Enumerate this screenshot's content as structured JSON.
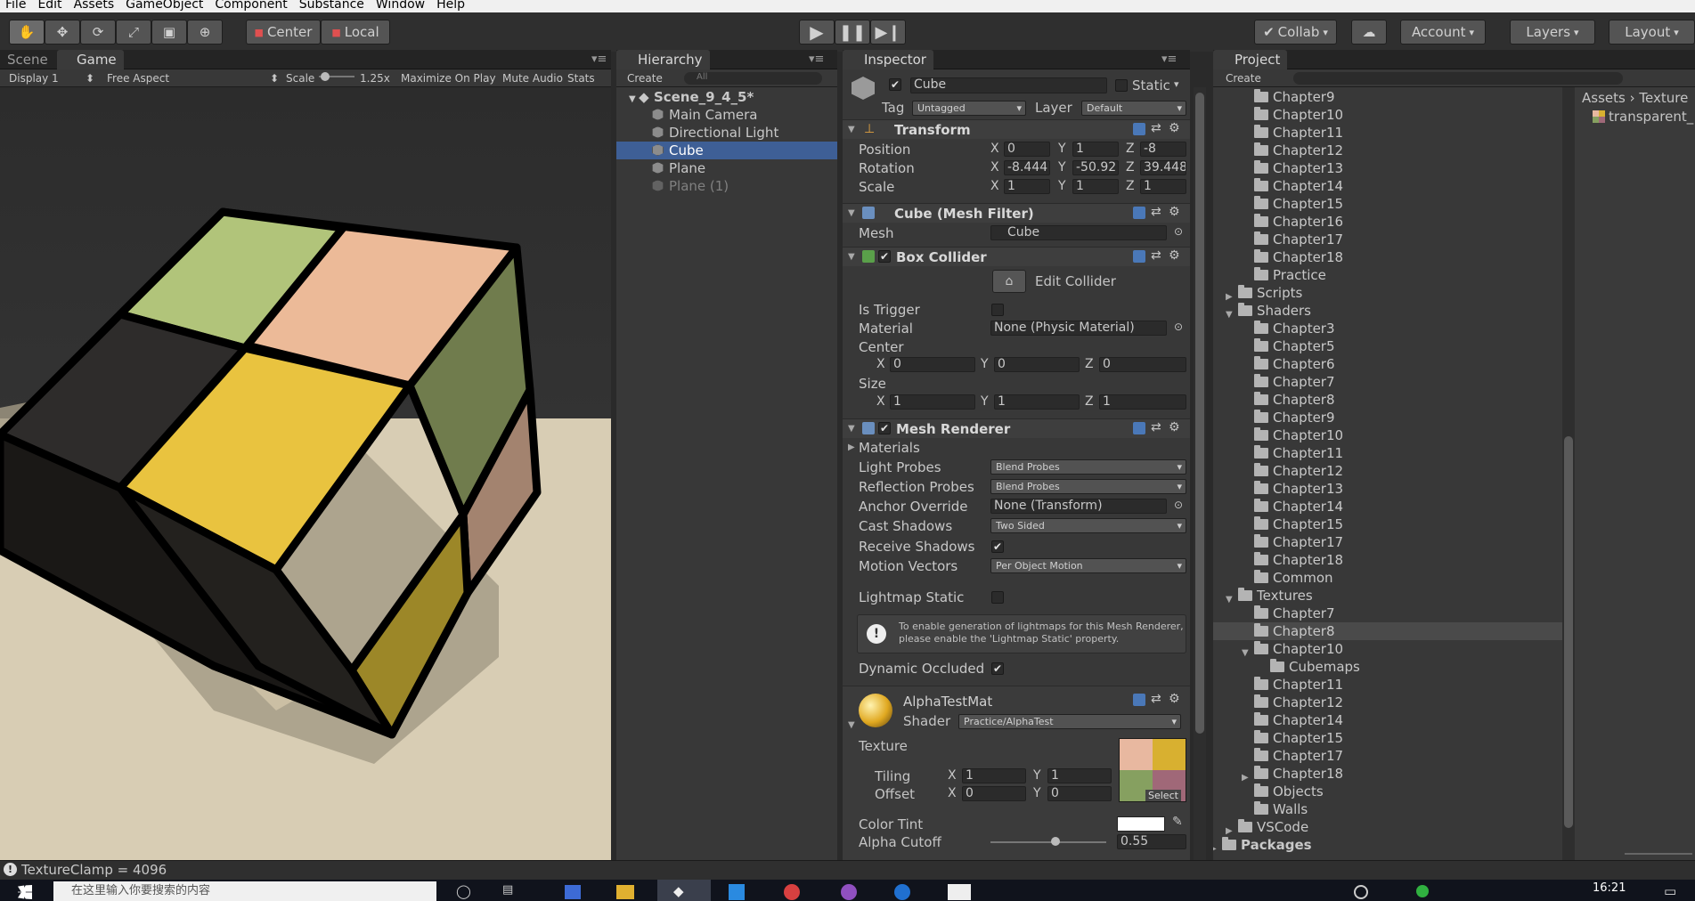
{
  "menu": [
    "File",
    "Edit",
    "Assets",
    "GameObject",
    "Component",
    "Substance",
    "Window",
    "Help"
  ],
  "toolbar": {
    "pivot": "Center",
    "space": "Local",
    "collab": "Collab",
    "account": "Account",
    "layers": "Layers",
    "layout": "Layout"
  },
  "game_panel": {
    "tab_scene": "Scene",
    "tab_game": "Game",
    "display": "Display 1",
    "aspect": "Free Aspect",
    "scale_label": "Scale",
    "scale_value": "1.25x",
    "maximize": "Maximize On Play",
    "mute": "Mute Audio",
    "stats": "Stats"
  },
  "hierarchy": {
    "tab": "Hierarchy",
    "create": "Create",
    "search_placeholder": "All",
    "scene": "Scene_9_4_5*",
    "items": [
      "Main Camera",
      "Directional Light",
      "Cube",
      "Plane",
      "Plane (1)"
    ]
  },
  "inspector": {
    "tab": "Inspector",
    "object_name": "Cube",
    "static_label": "Static",
    "tag_label": "Tag",
    "tag_value": "Untagged",
    "layer_label": "Layer",
    "layer_value": "Default",
    "transform": {
      "title": "Transform",
      "position_label": "Position",
      "rotation_label": "Rotation",
      "scale_label": "Scale",
      "position": [
        "0",
        "1",
        "-8"
      ],
      "rotation": [
        "-8.444",
        "-50.92",
        "39.448"
      ],
      "scale": [
        "1",
        "1",
        "1"
      ]
    },
    "mesh_filter": {
      "title": "Cube (Mesh Filter)",
      "mesh_label": "Mesh",
      "mesh_value": "Cube"
    },
    "box_collider": {
      "title": "Box Collider",
      "edit": "Edit Collider",
      "is_trigger": "Is Trigger",
      "material_label": "Material",
      "material_value": "None (Physic Material)",
      "center_label": "Center",
      "center": [
        "0",
        "0",
        "0"
      ],
      "size_label": "Size",
      "size": [
        "1",
        "1",
        "1"
      ]
    },
    "mesh_renderer": {
      "title": "Mesh Renderer",
      "materials": "Materials",
      "light_probes_label": "Light Probes",
      "light_probes": "Blend Probes",
      "reflection_probes_label": "Reflection Probes",
      "reflection_probes": "Blend Probes",
      "anchor_label": "Anchor Override",
      "anchor_value": "None (Transform)",
      "cast_label": "Cast Shadows",
      "cast_value": "Two Sided",
      "receive_label": "Receive Shadows",
      "motion_label": "Motion Vectors",
      "motion_value": "Per Object Motion",
      "lightmap_label": "Lightmap Static",
      "info_text": "To enable generation of lightmaps for this Mesh Renderer, please enable the 'Lightmap Static' property.",
      "dynamic_label": "Dynamic Occluded"
    },
    "material": {
      "name": "AlphaTestMat",
      "shader_label": "Shader",
      "shader_value": "Practice/AlphaTest",
      "texture_label": "Texture",
      "tiling_label": "Tiling",
      "tiling": [
        "1",
        "1"
      ],
      "offset_label": "Offset",
      "offset": [
        "0",
        "0"
      ],
      "select": "Select",
      "tint_label": "Color Tint",
      "cutoff_label": "Alpha Cutoff",
      "cutoff_value": "0.55"
    },
    "axes": [
      "X",
      "Y",
      "Z"
    ]
  },
  "project": {
    "tab": "Project",
    "create": "Create",
    "tree": [
      {
        "label": "Chapter9",
        "indent": 3
      },
      {
        "label": "Chapter10",
        "indent": 3
      },
      {
        "label": "Chapter11",
        "indent": 3
      },
      {
        "label": "Chapter12",
        "indent": 3
      },
      {
        "label": "Chapter13",
        "indent": 3
      },
      {
        "label": "Chapter14",
        "indent": 3
      },
      {
        "label": "Chapter15",
        "indent": 3
      },
      {
        "label": "Chapter16",
        "indent": 3
      },
      {
        "label": "Chapter17",
        "indent": 3
      },
      {
        "label": "Chapter18",
        "indent": 3
      },
      {
        "label": "Practice",
        "indent": 3
      },
      {
        "label": "Scripts",
        "indent": 2,
        "arrow": "▶"
      },
      {
        "label": "Shaders",
        "indent": 2,
        "arrow": "▼"
      },
      {
        "label": "Chapter3",
        "indent": 3
      },
      {
        "label": "Chapter5",
        "indent": 3
      },
      {
        "label": "Chapter6",
        "indent": 3
      },
      {
        "label": "Chapter7",
        "indent": 3
      },
      {
        "label": "Chapter8",
        "indent": 3
      },
      {
        "label": "Chapter9",
        "indent": 3
      },
      {
        "label": "Chapter10",
        "indent": 3
      },
      {
        "label": "Chapter11",
        "indent": 3
      },
      {
        "label": "Chapter12",
        "indent": 3
      },
      {
        "label": "Chapter13",
        "indent": 3
      },
      {
        "label": "Chapter14",
        "indent": 3
      },
      {
        "label": "Chapter15",
        "indent": 3
      },
      {
        "label": "Chapter17",
        "indent": 3
      },
      {
        "label": "Chapter18",
        "indent": 3
      },
      {
        "label": "Common",
        "indent": 3
      },
      {
        "label": "Textures",
        "indent": 2,
        "arrow": "▼"
      },
      {
        "label": "Chapter7",
        "indent": 3
      },
      {
        "label": "Chapter8",
        "indent": 3,
        "selected": true
      },
      {
        "label": "Chapter10",
        "indent": 3,
        "arrow": "▼"
      },
      {
        "label": "Cubemaps",
        "indent": 4
      },
      {
        "label": "Chapter11",
        "indent": 3
      },
      {
        "label": "Chapter12",
        "indent": 3
      },
      {
        "label": "Chapter14",
        "indent": 3
      },
      {
        "label": "Chapter15",
        "indent": 3
      },
      {
        "label": "Chapter17",
        "indent": 3
      },
      {
        "label": "Chapter18",
        "indent": 3,
        "arrow": "▶"
      },
      {
        "label": "Objects",
        "indent": 3
      },
      {
        "label": "Walls",
        "indent": 3
      },
      {
        "label": "VSCode",
        "indent": 2,
        "arrow": "▶"
      },
      {
        "label": "Packages",
        "indent": 1,
        "arrow": "▶",
        "bold": true
      }
    ],
    "breadcrumb": [
      "Assets",
      "Texture"
    ],
    "asset": "transparent_"
  },
  "status": "TextureClamp = 4096",
  "taskbar": {
    "search_placeholder": "在这里输入你要搜索的内容",
    "time": "16:21"
  }
}
